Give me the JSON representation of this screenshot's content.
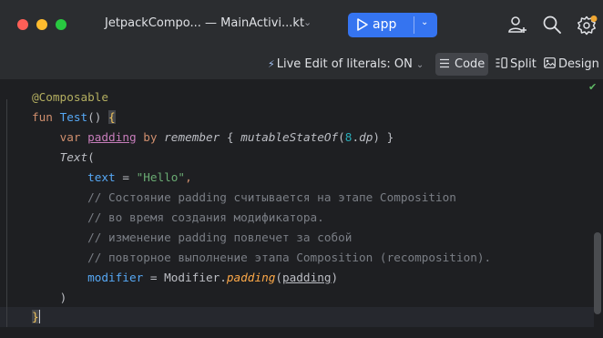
{
  "window": {
    "title": "JetpackCompo... — MainActivi...kt",
    "title_chevron": "⌄",
    "run_config_label": "app",
    "run_config_chevron": "⌄",
    "colors": {
      "accent": "#3574f0",
      "titlebar": "#2b2d30",
      "editor_bg": "#1e1f22"
    },
    "icons": [
      "play-icon",
      "account-add-icon",
      "search-icon",
      "settings-icon"
    ]
  },
  "toolbar": {
    "live_edit_label": "Live Edit of literals: ON",
    "live_edit_caret": "⌄",
    "modes": {
      "code": "Code",
      "split": "Split",
      "design": "Design"
    },
    "selected_mode": "Code"
  },
  "editor": {
    "inspection_status_icon": "check-icon",
    "lines": {
      "l1": {
        "annotation": "@Composable"
      },
      "l2": {
        "kw": "fun",
        "name": "Test",
        "parens": "()",
        "brace": "{"
      },
      "l3": {
        "kw": "var",
        "prop": "padding",
        "by": "by",
        "remember": "remember",
        "open": "{",
        "call": "mutableStateOf",
        "arg_open": "(",
        "num": "8",
        "dot": ".",
        "dp": "dp",
        "arg_close": ")",
        "close": "}"
      },
      "l4": {
        "call": "Text",
        "paren": "("
      },
      "l5": {
        "param": "text",
        "eq": "=",
        "str": "\"Hello\"",
        "comma": ","
      },
      "l6": {
        "comment": "// Состояние padding считывается на этапе Composition"
      },
      "l7": {
        "comment": "// во время создания модификатора."
      },
      "l8": {
        "comment": "// изменение padding повлечет за собой"
      },
      "l9": {
        "comment": "// повторное выполнение этапа Composition (recomposition)."
      },
      "l10": {
        "param": "modifier",
        "eq": "=",
        "obj": "Modifier",
        "dot": ".",
        "fn": "padding",
        "open": "(",
        "arg": "padding",
        "close": ")"
      },
      "l11": {
        "paren": ")"
      },
      "l12": {
        "brace": "}"
      }
    }
  }
}
